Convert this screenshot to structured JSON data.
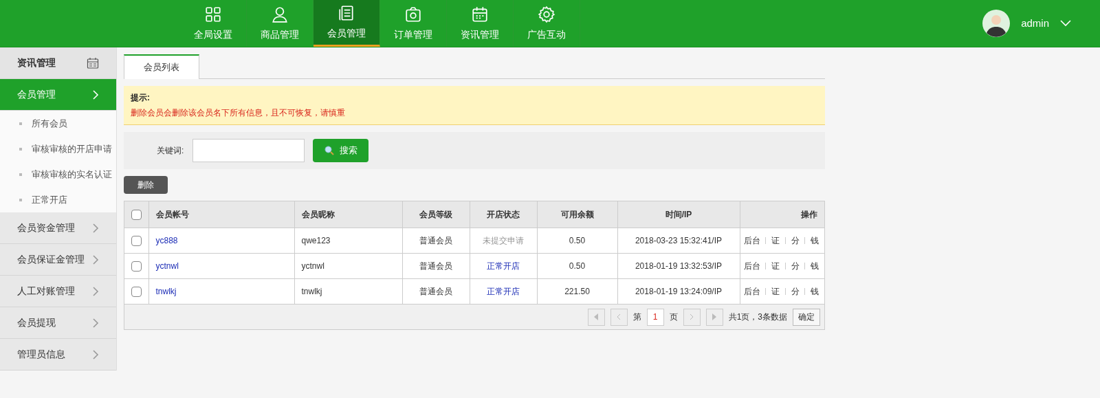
{
  "nav": [
    {
      "label": "全局设置",
      "kind": "grid",
      "selected": false
    },
    {
      "label": "商品管理",
      "kind": "user",
      "selected": false
    },
    {
      "label": "会员管理",
      "kind": "doc",
      "selected": true
    },
    {
      "label": "订单管理",
      "kind": "camera",
      "selected": false
    },
    {
      "label": "资讯管理",
      "kind": "calendar",
      "selected": false
    },
    {
      "label": "广告互动",
      "kind": "gear",
      "selected": false
    }
  ],
  "user": {
    "name": "admin"
  },
  "sidebar": {
    "title": "资讯管理",
    "groups": [
      {
        "label": "会员管理",
        "expanded": true,
        "children": [
          {
            "label": "所有会员"
          },
          {
            "label": "审核审核的开店申请"
          },
          {
            "label": "审核审核的实名认证"
          },
          {
            "label": "正常开店"
          }
        ]
      },
      {
        "label": "会员资金管理",
        "expanded": false
      },
      {
        "label": "会员保证金管理",
        "expanded": false
      },
      {
        "label": "人工对账管理",
        "expanded": false
      },
      {
        "label": "会员提现",
        "expanded": false
      },
      {
        "label": "管理员信息",
        "expanded": false
      }
    ]
  },
  "tabs": [
    {
      "label": "会员列表",
      "selected": true
    }
  ],
  "notice": {
    "title": "提示:",
    "text": "删除会员会删除该会员名下所有信息，且不可恢复，请慎重"
  },
  "search": {
    "label": "关键词:",
    "button": "搜索"
  },
  "delete_button": "删除",
  "table": {
    "all_checked": false,
    "columns": [
      "会员帐号",
      "会员昵称",
      "会员等级",
      "开店状态",
      "可用余额",
      "时间/IP",
      "操作"
    ],
    "rows": [
      {
        "checked": false,
        "account": "yc888",
        "nickname": "qwe123",
        "level": "普通会员",
        "status": {
          "kind": "pending",
          "text": "未提交申请"
        },
        "balance": "0.50",
        "time": "2018-03-23 15:32:41/IP",
        "actions": [
          "后台",
          "证",
          "分",
          "钱"
        ]
      },
      {
        "checked": false,
        "account": "yctnwl",
        "nickname": "yctnwl",
        "level": "普通会员",
        "status": {
          "kind": "open",
          "text": "正常开店"
        },
        "balance": "0.50",
        "time": "2018-01-19 13:32:53/IP",
        "actions": [
          "后台",
          "证",
          "分",
          "钱"
        ]
      },
      {
        "checked": false,
        "account": "tnwlkj",
        "nickname": "tnwlkj",
        "level": "普通会员",
        "status": {
          "kind": "open",
          "text": "正常开店"
        },
        "balance": "221.50",
        "time": "2018-01-19 13:24:09/IP",
        "actions": [
          "后台",
          "证",
          "分",
          "钱"
        ]
      }
    ]
  },
  "pagination": {
    "prefix": "第",
    "page": "1",
    "suffix": "页",
    "summary": "共1页，3条数据",
    "confirm": "确定"
  }
}
